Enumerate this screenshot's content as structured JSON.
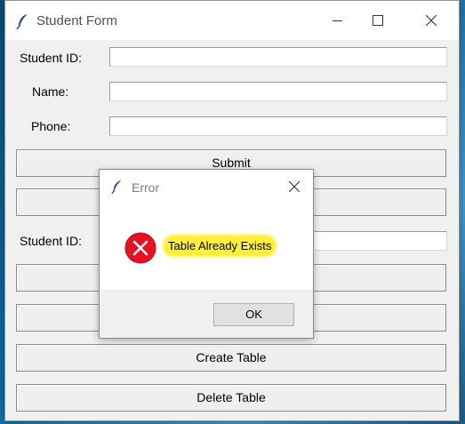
{
  "window": {
    "title": "Student Form",
    "title_icon": "feather-icon"
  },
  "form": {
    "student_id_label": "Student ID:",
    "student_id_value": "",
    "name_label": "Name:",
    "name_value": "",
    "phone_label": "Phone:",
    "phone_value": "",
    "submit_label": "Submit",
    "search_student_id_label": "Student ID:",
    "search_student_id_value": "",
    "create_table_label": "Create Table",
    "delete_table_label": "Delete Table"
  },
  "dialog": {
    "title": "Error",
    "icon": "error-icon",
    "message": "Table Already Exists",
    "ok_label": "OK",
    "highlight_color": "#ffef3a",
    "error_color": "#e81123"
  }
}
